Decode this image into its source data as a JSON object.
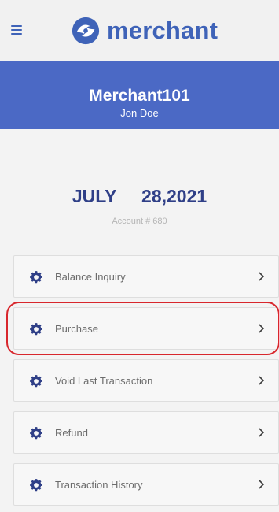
{
  "app": {
    "logo_text": "merchant"
  },
  "header": {
    "merchant_name": "Merchant101",
    "user_name": "Jon Doe"
  },
  "date": {
    "month": "JULY",
    "day_year": "28,2021",
    "account": "Account # 680"
  },
  "menu": {
    "items": [
      {
        "label": "Balance Inquiry",
        "icon": "gear-icon"
      },
      {
        "label": "Purchase",
        "icon": "gear-icon",
        "highlighted": true
      },
      {
        "label": "Void Last Transaction",
        "icon": "gear-icon"
      },
      {
        "label": "Refund",
        "icon": "gear-icon"
      },
      {
        "label": "Transaction History",
        "icon": "gear-icon"
      }
    ]
  },
  "colors": {
    "brand": "#3f63b8",
    "header_band": "#4b69c5",
    "date_text": "#2f3f87",
    "highlight": "#d8262c"
  }
}
